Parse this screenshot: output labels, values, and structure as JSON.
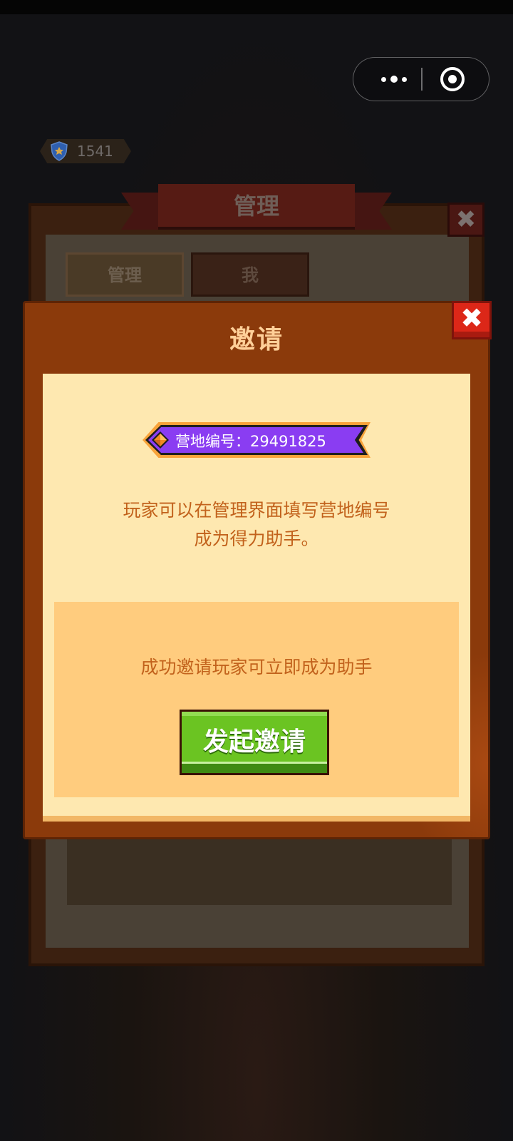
{
  "score": "1541",
  "background_panel": {
    "title": "管理",
    "close": "✖",
    "tabs": [
      "管理",
      "我"
    ]
  },
  "invite_modal": {
    "title": "邀请",
    "close": "✖",
    "camp_id_label": "营地编号：29491825",
    "description": [
      "玩家可以在管理界面填写营地编号",
      "成为得力助手。"
    ],
    "hint": "成功邀请玩家可立即成为助手",
    "invite_button": "发起邀请"
  },
  "icons": {
    "more": "more-dots-icon",
    "close_mini": "target-close-icon",
    "shield": "shield-icon",
    "gem": "gem-icon"
  },
  "colors": {
    "modal_border": "#8b3a0b",
    "content_bg": "#fee8b0",
    "box_bg": "#ffcc7e",
    "text_orange": "#c2621c",
    "button_green": "#6bc422",
    "close_red": "#dc2718",
    "camp_purple": "#8a3df2"
  }
}
